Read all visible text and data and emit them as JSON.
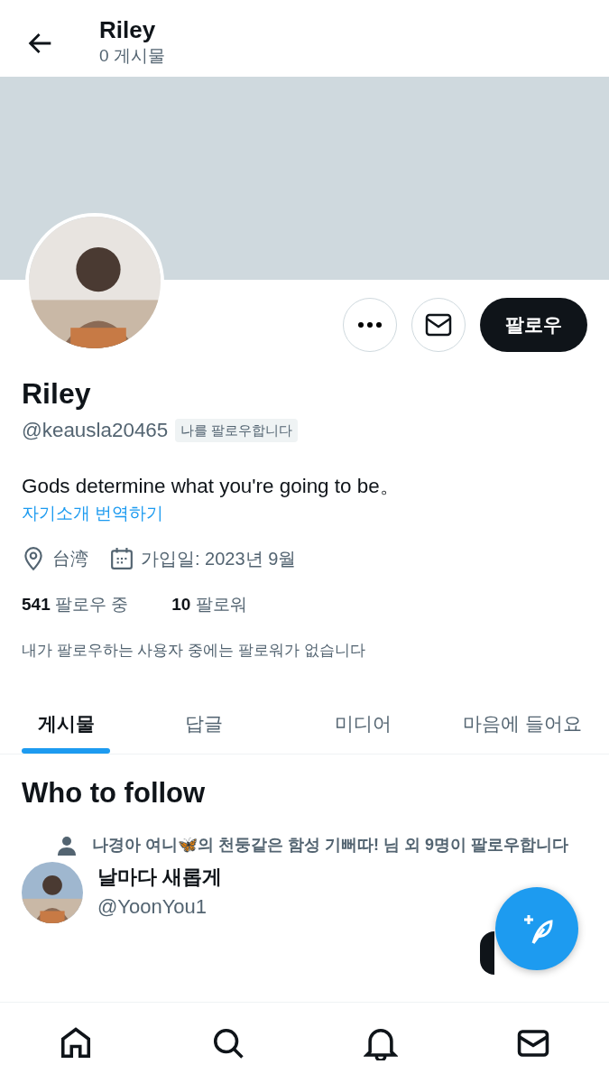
{
  "header": {
    "title": "Riley",
    "post_count": "0 게시물"
  },
  "profile": {
    "name": "Riley",
    "handle": "@keausla20465",
    "follows_you_badge": "나를 팔로우합니다",
    "bio": "Gods determine what you're going to be。",
    "translate_link": "자기소개 번역하기",
    "location": "台湾",
    "joined": "가입일: 2023년 9월",
    "following": "**541** 팔로우 중",
    "followers": "**10** 팔로워",
    "followers_you_know": "내가 팔로우하는 사용자 중에는 팔로워가 없습니다",
    "follow_button": "팔로우"
  },
  "tabs": [
    {
      "label": "게시물",
      "selected": true
    },
    {
      "label": "답글",
      "selected": false
    },
    {
      "label": "미디어",
      "selected": false
    },
    {
      "label": "마음에 들어요",
      "selected": false
    }
  ],
  "who_to_follow": {
    "title": "Who to follow",
    "items": [
      {
        "context": "나경아 여니🦋의 천둥같은 함성 기뻐따! 님 외 9명이 팔로우합니다",
        "name": "날마다 새롭게",
        "handle": "@YoonYou1"
      }
    ]
  },
  "bottom_nav": [
    {
      "kind": "home"
    },
    {
      "kind": "search"
    },
    {
      "kind": "bell"
    },
    {
      "kind": "mail"
    }
  ]
}
